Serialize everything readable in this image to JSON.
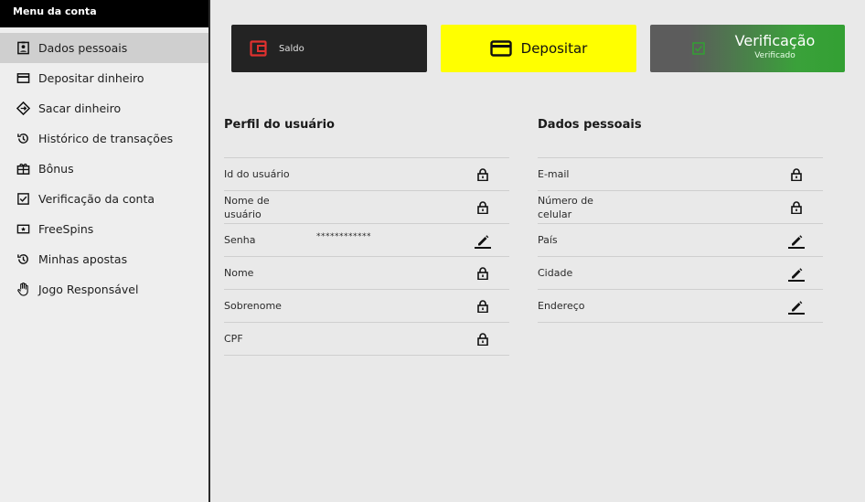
{
  "sidebar": {
    "header": "Menu da conta",
    "items": [
      {
        "label": "Dados pessoais",
        "icon": "id-badge-icon",
        "active": true
      },
      {
        "label": "Depositar dinheiro",
        "icon": "credit-card-icon"
      },
      {
        "label": "Sacar dinheiro",
        "icon": "withdraw-diamond-icon"
      },
      {
        "label": "Histórico de transações",
        "icon": "history-icon"
      },
      {
        "label": "Bônus",
        "icon": "gift-icon"
      },
      {
        "label": "Verificação da conta",
        "icon": "checkbox-icon"
      },
      {
        "label": "FreeSpins",
        "icon": "ticket-icon"
      },
      {
        "label": "Minhas apostas",
        "icon": "history-icon"
      },
      {
        "label": "Jogo Responsável",
        "icon": "hand-icon"
      }
    ]
  },
  "cards": {
    "saldo_label": "Saldo",
    "depositar_label": "Depositar",
    "verificacao_title": "Verificação",
    "verificacao_status": "Verificado"
  },
  "profile": {
    "title": "Perfil do usuário",
    "rows": [
      {
        "label": "Id do usuário",
        "value": "",
        "action": "lock"
      },
      {
        "label": "Nome de usuário",
        "value": "",
        "action": "lock"
      },
      {
        "label": "Senha",
        "value": "************",
        "action": "edit"
      },
      {
        "label": "Nome",
        "value": "",
        "action": "lock"
      },
      {
        "label": "Sobrenome",
        "value": "",
        "action": "lock"
      },
      {
        "label": "CPF",
        "value": "",
        "action": "lock"
      }
    ]
  },
  "personal": {
    "title": "Dados pessoais",
    "rows": [
      {
        "label": "E-mail",
        "value": "",
        "action": "lock"
      },
      {
        "label": "Número de celular",
        "value": "",
        "action": "lock"
      },
      {
        "label": "País",
        "value": "",
        "action": "edit"
      },
      {
        "label": "Cidade",
        "value": "",
        "action": "edit"
      },
      {
        "label": "Endereço",
        "value": "",
        "action": "edit"
      }
    ]
  },
  "colors": {
    "deposit_bg": "#ffff00",
    "saldo_bg": "#232323",
    "saldo_icon": "#e0312f",
    "verify_green": "#33a033"
  }
}
